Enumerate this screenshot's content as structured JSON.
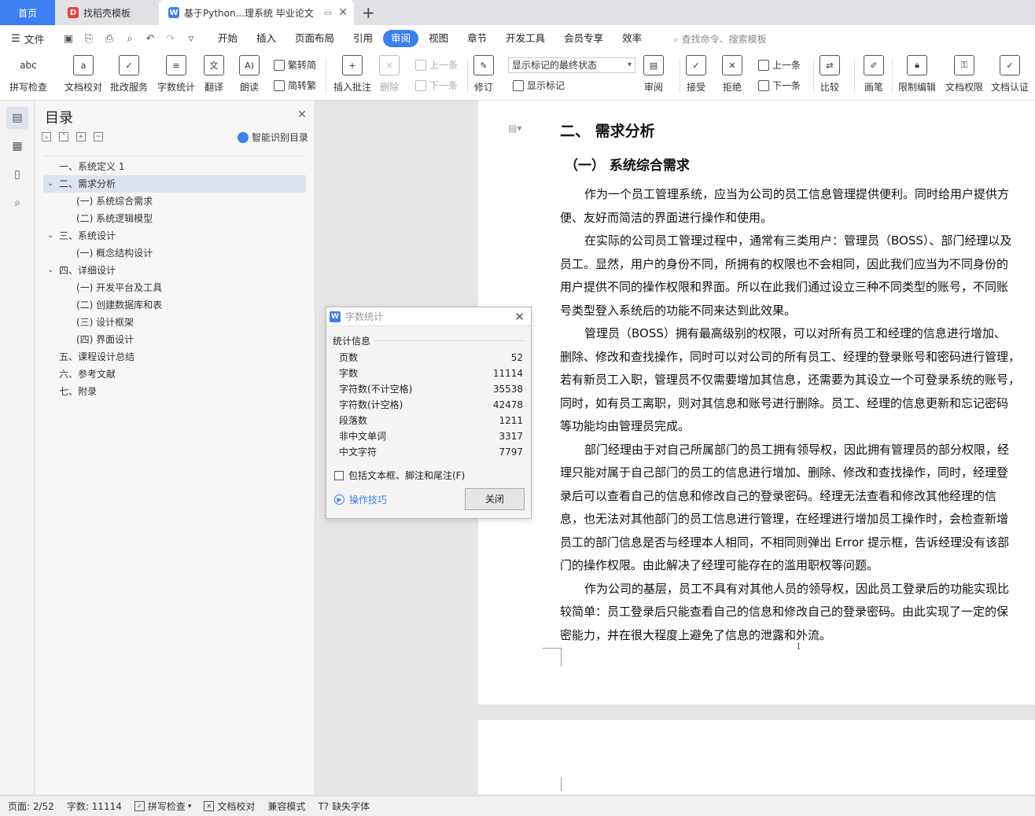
{
  "tabs": {
    "home": "首页",
    "template": "找稻壳模板",
    "document": "基于Python...理系统 毕业论文"
  },
  "menu": {
    "file": "文件",
    "items": [
      "开始",
      "插入",
      "页面布局",
      "引用",
      "审阅",
      "视图",
      "章节",
      "开发工具",
      "会员专享",
      "效率"
    ],
    "active": "审阅",
    "search": "查找命令、搜索模板"
  },
  "ribbon": {
    "spell_check": "拼写检查",
    "doc_proof": "文档校对",
    "review_service": "批改服务",
    "word_count": "字数统计",
    "translate": "翻译",
    "read_aloud": "朗读",
    "trad_to_simp": "繁转简",
    "simp_to_trad": "简转繁",
    "insert_comment": "插入批注",
    "delete": "删除",
    "prev": "上一条",
    "next": "下一条",
    "track_changes": "修订",
    "display_select": "显示标记的最终状态",
    "show_markup": "显示标记",
    "review": "审阅",
    "accept": "接受",
    "reject": "拒绝",
    "prev2": "上一条",
    "next2": "下一条",
    "compare": "比较",
    "ink": "画笔",
    "restrict_edit": "限制编辑",
    "doc_permission": "文档权限",
    "doc_cert": "文档认证"
  },
  "toc": {
    "title": "目录",
    "smart": "智能识别目录",
    "items": [
      "一、系统定义 1",
      "二、需求分析",
      "(一) 系统综合需求",
      "(二) 系统逻辑模型",
      "三、系统设计",
      "(一) 概念结构设计",
      "四、详细设计",
      "(一) 开发平台及工具",
      "(二) 创建数据库和表",
      "(三) 设计框架",
      "(四) 界面设计",
      "五、课程设计总结",
      "六、参考文献",
      "七、附录"
    ]
  },
  "document": {
    "heading": "二、 需求分析",
    "subheading": "（一）   系统综合需求",
    "lines": [
      "作为一个员工管理系统，应当为公司的员工信息管理提供便利。同时给用户提供方",
      "便、友好而简洁的界面进行操作和使用。",
      "在实际的公司员工管理过程中，通常有三类用户：管理员（BOSS）、部门经理以及",
      "员工。显然，用户的身份不同，所拥有的权限也不会相同，因此我们应当为不同身份的",
      "用户提供不同的操作权限和界面。所以在此我们通过设立三种不同类型的账号，不同账",
      "号类型登入系统后的功能不同来达到此效果。",
      "管理员（BOSS）拥有最高级别的权限，可以对所有员工和经理的信息进行增加、",
      "删除、修改和查找操作，同时可以对公司的所有员工、经理的登录账号和密码进行管理，",
      "若有新员工入职，管理员不仅需要增加其信息，还需要为其设立一个可登录系统的账号，",
      "同时，如有员工离职，则对其信息和账号进行删除。员工、经理的信息更新和忘记密码",
      "等功能均由管理员完成。",
      "部门经理由于对自己所属部门的员工拥有领导权，因此拥有管理员的部分权限，经",
      "理只能对属于自己部门的员工的信息进行增加、删除、修改和查找操作，同时，经理登",
      "录后可以查看自己的信息和修改自己的登录密码。经理无法查看和修改其他经理的信",
      "息，也无法对其他部门的员工信息进行管理，在经理进行增加员工操作时，会检查新增",
      "员工的部门信息是否与经理本人相同，不相同则弹出 Error 提示框，告诉经理没有该部",
      "门的操作权限。由此解决了经理可能存在的滥用职权等问题。",
      "作为公司的基层，员工不具有对其他人员的领导权，因此员工登录后的功能实现比",
      "较简单：员工登录后只能查看自己的信息和修改自己的登录密码。由此实现了一定的保",
      "密能力，并在很大程度上避免了信息的泄露和外流。"
    ],
    "page_number": "1"
  },
  "dialog": {
    "title": "字数统计",
    "section": "统计信息",
    "rows": [
      {
        "label": "页数",
        "value": "52"
      },
      {
        "label": "字数",
        "value": "11114"
      },
      {
        "label": "字符数(不计空格)",
        "value": "35538"
      },
      {
        "label": "字符数(计空格)",
        "value": "42478"
      },
      {
        "label": "段落数",
        "value": "1211"
      },
      {
        "label": "非中文单词",
        "value": "3317"
      },
      {
        "label": "中文字符",
        "value": "7797"
      }
    ],
    "checkbox": "包括文本框、脚注和尾注(F)",
    "tips": "操作技巧",
    "close": "关闭"
  },
  "status": {
    "page": "页面: 2/52",
    "words": "字数: 11114",
    "spell": "拼写检查",
    "proof": "文档校对",
    "compat": "兼容模式",
    "missing_font": "缺失字体"
  },
  "colors": {
    "accent": "#3b7ff0",
    "wps_red": "#e8403a"
  }
}
